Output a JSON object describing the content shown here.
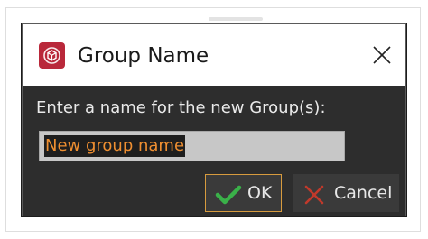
{
  "dialog": {
    "title": "Group Name",
    "prompt": "Enter a name for the new Group(s):",
    "input": {
      "value": "New group name",
      "selected": true
    },
    "buttons": {
      "ok_label": "OK",
      "cancel_label": "Cancel"
    },
    "icons": {
      "app": "app-logo-icon",
      "close": "close-icon",
      "ok": "checkmark-icon",
      "cancel": "x-icon"
    }
  },
  "colors": {
    "app_icon_bg": "#b9283a",
    "dialog_bg": "#2d2d2d",
    "input_bg": "#c7c7c7",
    "selection_bg": "#1e1e1e",
    "selection_text": "#ef8f31",
    "ok_border": "#d79b3e",
    "check_green": "#3ab149",
    "cancel_red": "#c0392b"
  }
}
